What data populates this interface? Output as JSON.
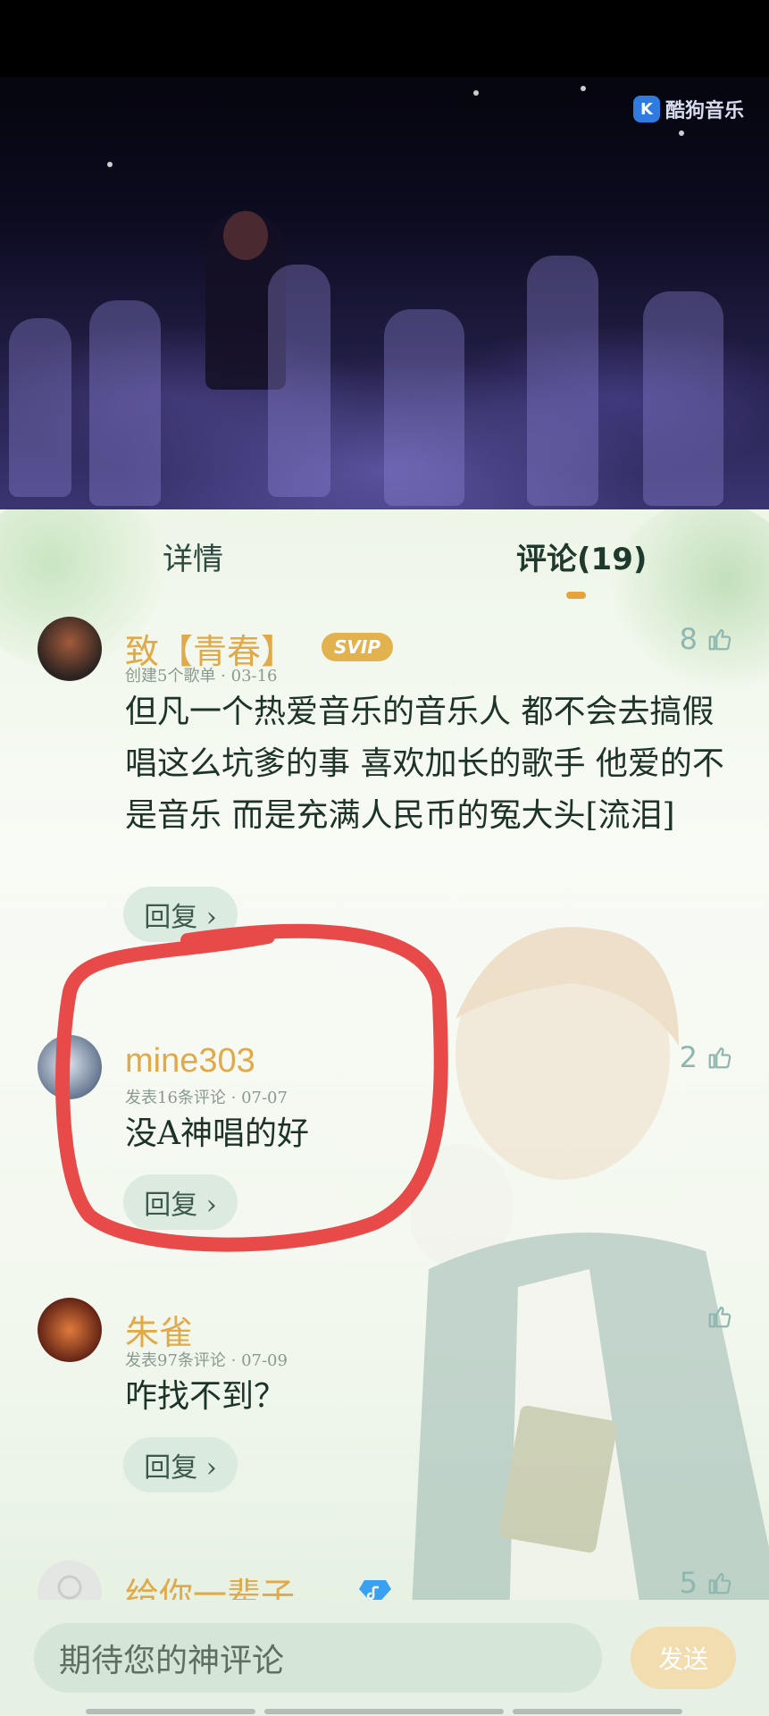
{
  "video": {
    "brand": "酷狗音乐",
    "brand_icon": "kugou-k-icon"
  },
  "tabs": [
    {
      "label": "详情",
      "active": false
    },
    {
      "label": "评论(19)",
      "active": true
    }
  ],
  "comments": [
    {
      "username": "致【青春】",
      "badge": "SVIP",
      "meta": "创建5个歌单 · 03-16",
      "content": "但凡一个热爱音乐的音乐人 都不会去搞假唱这么坑爹的事  喜欢加长的歌手 他爱的不是音乐 而是充满人民币的冤大头[流泪]",
      "likes": "8",
      "reply_label": "回复 ›"
    },
    {
      "username": "mine303",
      "meta": "发表16条评论 · 07-07",
      "content": "没A神唱的好",
      "likes": "2",
      "reply_label": "回复 ›"
    },
    {
      "username": "朱雀",
      "meta": "发表97条评论 · 07-09",
      "content": "咋找不到？",
      "likes": "",
      "reply_label": "回复 ›"
    },
    {
      "username": "给你一辈子、",
      "likes": "5"
    }
  ],
  "input": {
    "placeholder": "期待您的神评论",
    "send_label": "发送"
  },
  "colors": {
    "username": "#e0a94a",
    "accent": "#e8a23a",
    "highlight_stroke": "#e84a4a"
  }
}
